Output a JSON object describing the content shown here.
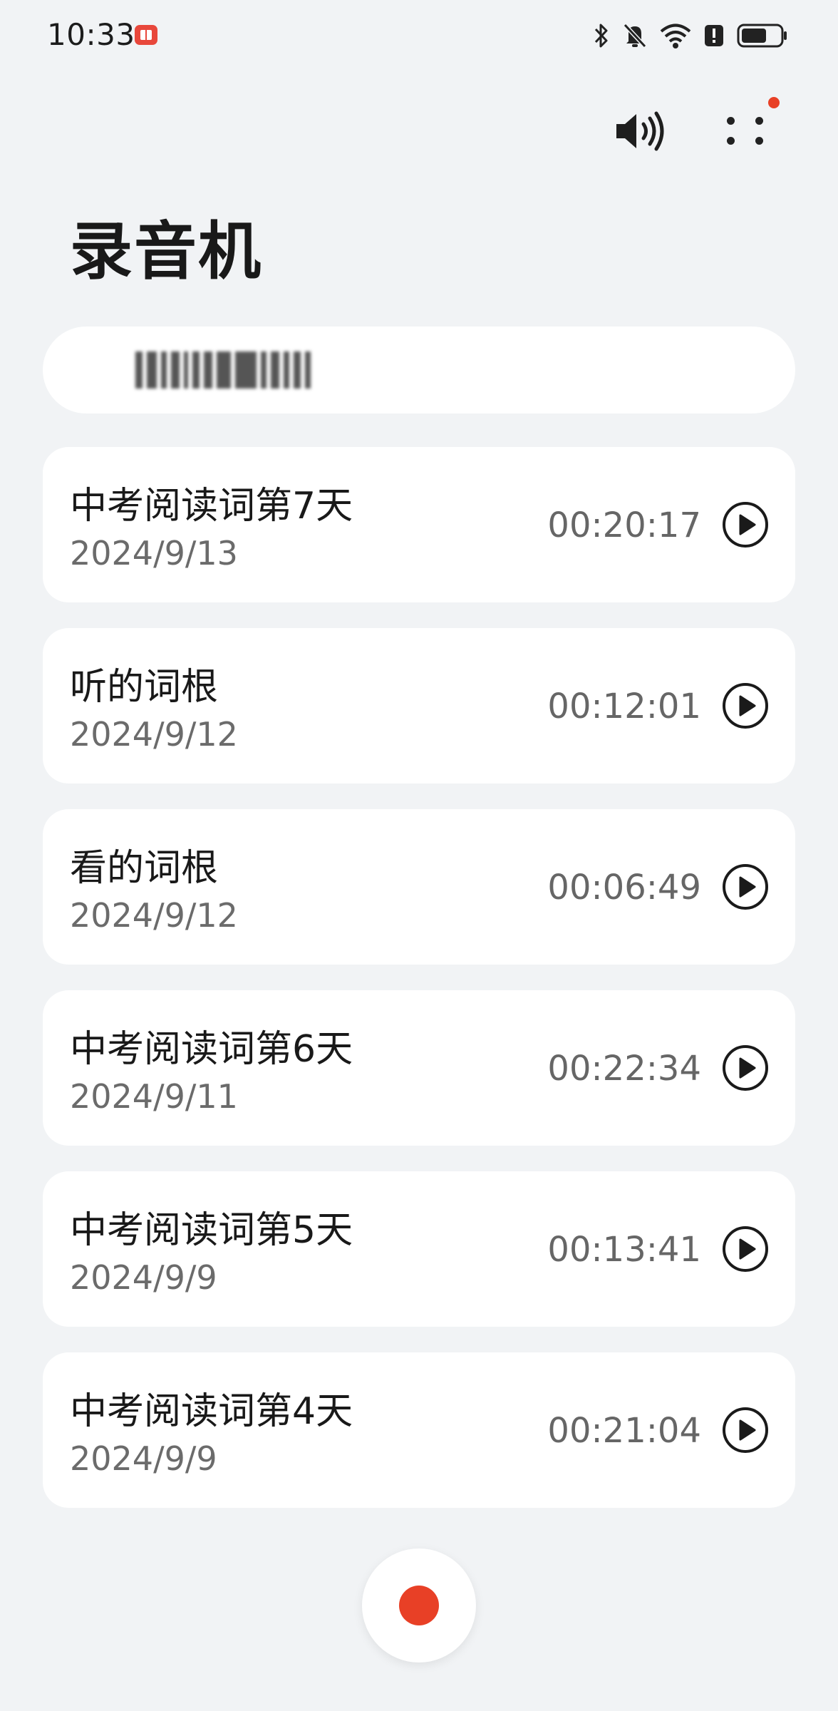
{
  "status_bar": {
    "time": "10:33",
    "icons": [
      "app-notification-icon",
      "bluetooth-icon",
      "mute-bell-icon",
      "wifi-icon",
      "alert-icon",
      "battery-icon"
    ]
  },
  "toolbar": {
    "speaker_icon": "speaker-icon",
    "more_icon": "more-icon",
    "badge_color": "#e84026"
  },
  "app": {
    "title": "录音机"
  },
  "search": {
    "placeholder": ""
  },
  "recordings": [
    {
      "title": "中考阅读词第7天",
      "date": "2024/9/13",
      "duration": "00:20:17"
    },
    {
      "title": "听的词根",
      "date": "2024/9/12",
      "duration": "00:12:01"
    },
    {
      "title": "看的词根",
      "date": "2024/9/12",
      "duration": "00:06:49"
    },
    {
      "title": "中考阅读词第6天",
      "date": "2024/9/11",
      "duration": "00:22:34"
    },
    {
      "title": "中考阅读词第5天",
      "date": "2024/9/9",
      "duration": "00:13:41"
    },
    {
      "title": "中考阅读词第4天",
      "date": "2024/9/9",
      "duration": "00:21:04"
    }
  ],
  "record_button": {
    "icon": "record-icon",
    "color": "#e84026"
  }
}
